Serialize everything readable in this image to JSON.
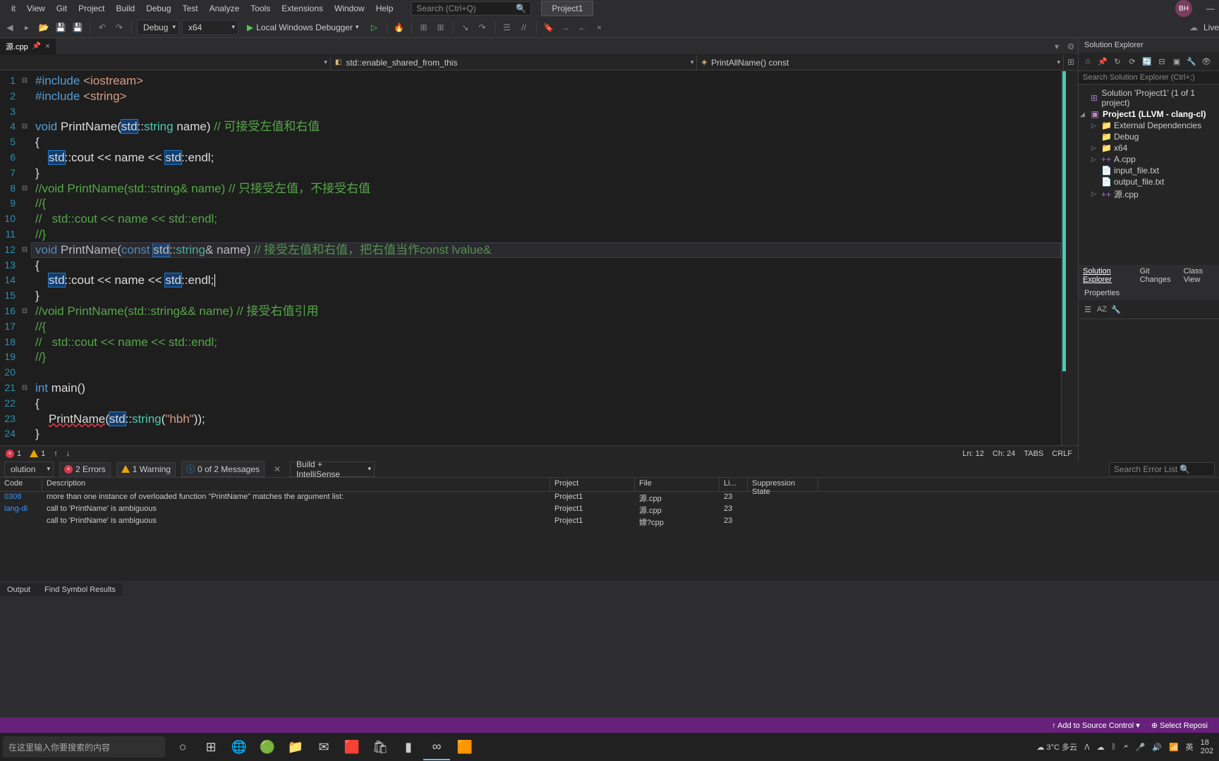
{
  "menu": {
    "items": [
      "it",
      "View",
      "Git",
      "Project",
      "Build",
      "Debug",
      "Test",
      "Analyze",
      "Tools",
      "Extensions",
      "Window",
      "Help"
    ],
    "search": "Search (Ctrl+Q)",
    "project": "Project1",
    "avatar": "BH",
    "live": "Live"
  },
  "toolbar": {
    "config": "Debug",
    "platform": "x64",
    "debugger": "Local Windows Debugger"
  },
  "tab": {
    "name": "源.cpp"
  },
  "nav": {
    "left": "",
    "mid": "std::enable_shared_from_this",
    "right": "PrintAllName() const"
  },
  "code": {
    "lines": [
      {
        "n": 1,
        "fold": "⊟",
        "seg": [
          {
            "t": "#include ",
            "c": "kw"
          },
          {
            "t": "<iostream>",
            "c": "str"
          }
        ]
      },
      {
        "n": 2,
        "fold": "",
        "seg": [
          {
            "t": "#include ",
            "c": "kw"
          },
          {
            "t": "<string>",
            "c": "str"
          }
        ]
      },
      {
        "n": 3,
        "fold": "",
        "seg": [
          {
            "t": ""
          }
        ]
      },
      {
        "n": 4,
        "fold": "⊟",
        "seg": [
          {
            "t": "void",
            "c": "kw"
          },
          {
            "t": " PrintName("
          },
          {
            "t": "std",
            "c": "hl"
          },
          {
            "t": "::"
          },
          {
            "t": "string",
            "c": "typ"
          },
          {
            "t": " name) "
          },
          {
            "t": "// 可接受左值和右值",
            "c": "cmt"
          }
        ]
      },
      {
        "n": 5,
        "fold": "",
        "seg": [
          {
            "t": "{"
          }
        ]
      },
      {
        "n": 6,
        "fold": "",
        "seg": [
          {
            "t": "    "
          },
          {
            "t": "std",
            "c": "hl"
          },
          {
            "t": "::cout << name << "
          },
          {
            "t": "std",
            "c": "hl"
          },
          {
            "t": "::endl;"
          }
        ]
      },
      {
        "n": 7,
        "fold": "",
        "seg": [
          {
            "t": "}"
          }
        ]
      },
      {
        "n": 8,
        "fold": "⊟",
        "seg": [
          {
            "t": "//void PrintName(std::string& name) // 只接受左值，不接受右值",
            "c": "cmt"
          }
        ]
      },
      {
        "n": 9,
        "fold": "",
        "seg": [
          {
            "t": "//{",
            "c": "cmt"
          }
        ]
      },
      {
        "n": 10,
        "fold": "",
        "seg": [
          {
            "t": "//   std::cout << name << std::endl;",
            "c": "cmt"
          }
        ]
      },
      {
        "n": 11,
        "fold": "",
        "seg": [
          {
            "t": "//}",
            "c": "cmt"
          }
        ]
      },
      {
        "n": 12,
        "fold": "⊟",
        "cur": true,
        "seg": [
          {
            "t": "void",
            "c": "kw"
          },
          {
            "t": " PrintName("
          },
          {
            "t": "const",
            "c": "kw"
          },
          {
            "t": " "
          },
          {
            "t": "std",
            "c": "hl"
          },
          {
            "t": "::"
          },
          {
            "t": "string",
            "c": "typ"
          },
          {
            "t": "& name) "
          },
          {
            "t": "// 接受左值和右值，把右值当作const lvalue&",
            "c": "cmt"
          }
        ]
      },
      {
        "n": 13,
        "fold": "",
        "seg": [
          {
            "t": "{"
          }
        ]
      },
      {
        "n": 14,
        "fold": "",
        "seg": [
          {
            "t": "    "
          },
          {
            "t": "std",
            "c": "hl"
          },
          {
            "t": "::cout << name << "
          },
          {
            "t": "std",
            "c": "hl"
          },
          {
            "t": "::endl;"
          }
        ]
      },
      {
        "n": 15,
        "fold": "",
        "seg": [
          {
            "t": "}"
          }
        ]
      },
      {
        "n": 16,
        "fold": "⊟",
        "seg": [
          {
            "t": "//void PrintName(std::string&& name) // 接受右值引用",
            "c": "cmt"
          }
        ]
      },
      {
        "n": 17,
        "fold": "",
        "seg": [
          {
            "t": "//{",
            "c": "cmt"
          }
        ]
      },
      {
        "n": 18,
        "fold": "",
        "seg": [
          {
            "t": "//   std::cout << name << std::endl;",
            "c": "cmt"
          }
        ]
      },
      {
        "n": 19,
        "fold": "",
        "seg": [
          {
            "t": "//}",
            "c": "cmt"
          }
        ]
      },
      {
        "n": 20,
        "fold": "",
        "seg": [
          {
            "t": ""
          }
        ]
      },
      {
        "n": 21,
        "fold": "⊟",
        "seg": [
          {
            "t": "int",
            "c": "kw"
          },
          {
            "t": " main()"
          }
        ]
      },
      {
        "n": 22,
        "fold": "",
        "seg": [
          {
            "t": "{"
          }
        ]
      },
      {
        "n": 23,
        "fold": "",
        "seg": [
          {
            "t": "    "
          },
          {
            "t": "PrintName",
            "c": "squiggle"
          },
          {
            "t": "("
          },
          {
            "t": "std",
            "c": "hl"
          },
          {
            "t": "::"
          },
          {
            "t": "string",
            "c": "typ"
          },
          {
            "t": "("
          },
          {
            "t": "\"hbh\"",
            "c": "str"
          },
          {
            "t": "));"
          }
        ]
      },
      {
        "n": 24,
        "fold": "",
        "seg": [
          {
            "t": "}"
          }
        ]
      }
    ]
  },
  "docbar": {
    "err": "1",
    "warn": "1",
    "up": "↑",
    "down": "↓",
    "ln": "Ln: 12",
    "ch": "Ch: 24",
    "tabs": "TABS",
    "crlf": "CRLF"
  },
  "errlist": {
    "filter": "olution",
    "errors": "2 Errors",
    "warnings": "1 Warning",
    "messages": "0 of 2 Messages",
    "build": "Build + IntelliSense",
    "search": "Search Error List",
    "cols": [
      "Code",
      "Description",
      "Project",
      "File",
      "Li...",
      "Suppression State"
    ],
    "rows": [
      {
        "code": "0308",
        "desc": "more than one instance of overloaded function \"PrintName\" matches the argument list:",
        "proj": "Project1",
        "file": "源.cpp",
        "line": "23"
      },
      {
        "code": "lang-di",
        "desc": "call to 'PrintName' is ambiguous",
        "proj": "Project1",
        "file": "源.cpp",
        "line": "23"
      },
      {
        "code": "",
        "desc": "call to 'PrintName' is ambiguous",
        "proj": "Project1",
        "file": "嫖?cpp",
        "line": "23"
      }
    ]
  },
  "bottabs": [
    "Output",
    "Find Symbol Results"
  ],
  "side": {
    "title": "Solution Explorer",
    "search": "Search Solution Explorer (Ctrl+;)",
    "nodes": [
      {
        "ind": 0,
        "exp": "",
        "ico": "sln",
        "lbl": "Solution 'Project1' (1 of 1 project)"
      },
      {
        "ind": 0,
        "exp": "◢",
        "ico": "proj",
        "lbl": "Project1 (LLVM - clang-cl)",
        "bold": true
      },
      {
        "ind": 1,
        "exp": "▷",
        "ico": "fold",
        "lbl": "External Dependencies"
      },
      {
        "ind": 1,
        "exp": "",
        "ico": "fold",
        "lbl": "Debug"
      },
      {
        "ind": 1,
        "exp": "▷",
        "ico": "fold",
        "lbl": "x64"
      },
      {
        "ind": 1,
        "exp": "▷",
        "ico": "cpp",
        "lbl": "A.cpp"
      },
      {
        "ind": 1,
        "exp": "",
        "ico": "txt",
        "lbl": "input_file.txt"
      },
      {
        "ind": 1,
        "exp": "",
        "ico": "txt",
        "lbl": "output_file.txt"
      },
      {
        "ind": 1,
        "exp": "▷",
        "ico": "cpp",
        "lbl": "源.cpp"
      }
    ],
    "tabs": [
      "Solution Explorer",
      "Git Changes",
      "Class View"
    ],
    "props": "Properties"
  },
  "status": {
    "add": "↑ Add to Source Control ▾",
    "repo": "⊕ Select Reposi"
  },
  "taskbar": {
    "search": "在这里输入你要搜索的内容",
    "weather": "3°C 多云",
    "time": "18",
    "date": "202"
  }
}
